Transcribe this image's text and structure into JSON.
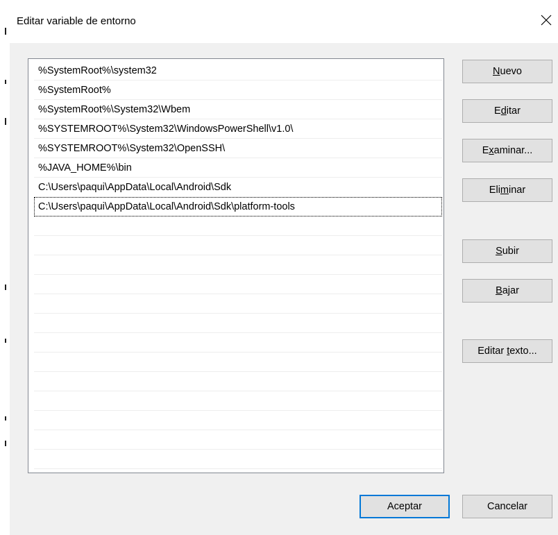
{
  "window": {
    "title": "Editar variable de entorno",
    "close_icon": "close-icon"
  },
  "list": {
    "items": [
      "%SystemRoot%\\system32",
      "%SystemRoot%",
      "%SystemRoot%\\System32\\Wbem",
      "%SYSTEMROOT%\\System32\\WindowsPowerShell\\v1.0\\",
      "%SYSTEMROOT%\\System32\\OpenSSH\\",
      "%JAVA_HOME%\\bin",
      "C:\\Users\\paqui\\AppData\\Local\\Android\\Sdk",
      "C:\\Users\\paqui\\AppData\\Local\\Android\\Sdk\\platform-tools"
    ],
    "focused_index": 7
  },
  "buttons": {
    "nuevo": {
      "pre": "",
      "key": "N",
      "post": "uevo"
    },
    "editar": {
      "pre": "E",
      "key": "d",
      "post": "itar"
    },
    "examinar": {
      "pre": "E",
      "key": "x",
      "post": "aminar..."
    },
    "eliminar": {
      "pre": "Eli",
      "key": "m",
      "post": "inar"
    },
    "subir": {
      "pre": "",
      "key": "S",
      "post": "ubir"
    },
    "bajar": {
      "pre": "",
      "key": "B",
      "post": "ajar"
    },
    "editar_texto": {
      "pre": "Editar ",
      "key": "t",
      "post": "exto..."
    },
    "aceptar": "Aceptar",
    "cancelar": "Cancelar"
  },
  "colors": {
    "dialog_bg": "#f0f0f0",
    "button_bg": "#e1e1e1",
    "default_button_border": "#0078d7"
  }
}
